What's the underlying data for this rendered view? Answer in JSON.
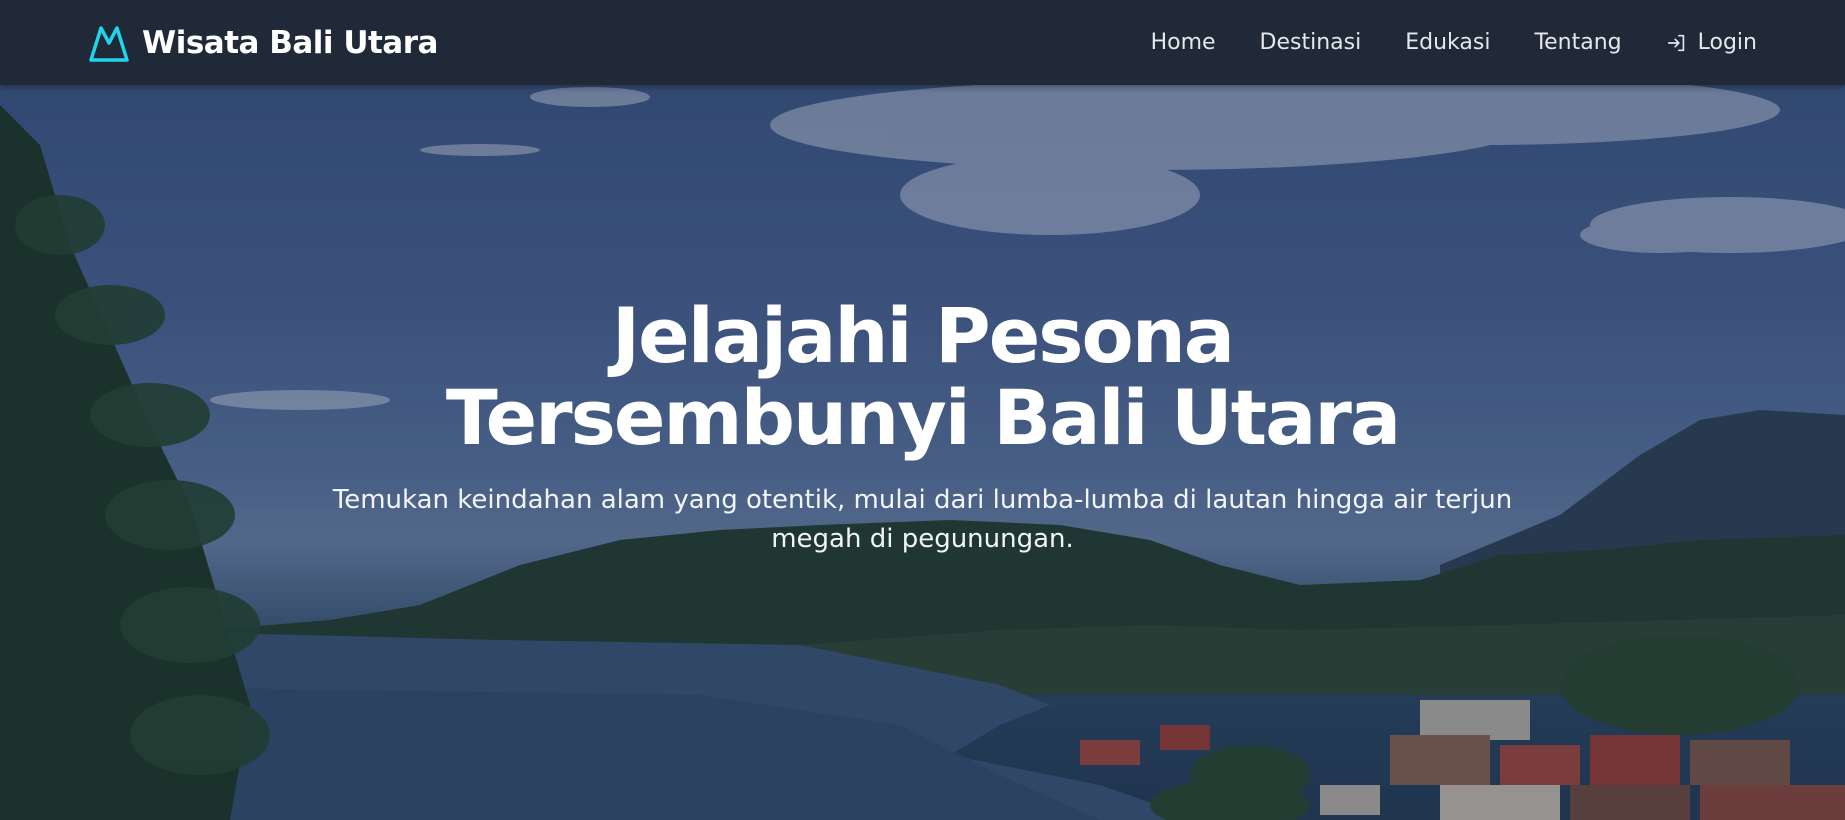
{
  "brand": {
    "name": "Wisata Bali Utara",
    "icon": "mountain-icon",
    "accent": "#22d3ee"
  },
  "nav": {
    "items": [
      {
        "label": "Home"
      },
      {
        "label": "Destinasi"
      },
      {
        "label": "Edukasi"
      },
      {
        "label": "Tentang"
      }
    ],
    "login": {
      "label": "Login",
      "icon": "login-icon"
    }
  },
  "hero": {
    "title_line1": "Jelajahi Pesona",
    "title_line2": "Tersembunyi Bali Utara",
    "subtitle": "Temukan keindahan alam yang otentik, mulai dari lumba-lumba di lautan hingga air terjun megah di pegunungan.",
    "background": "lake-village-landscape-photo"
  },
  "colors": {
    "navbar_bg": "#1f2937",
    "nav_text": "#e5e7eb",
    "hero_text": "#ffffff"
  }
}
